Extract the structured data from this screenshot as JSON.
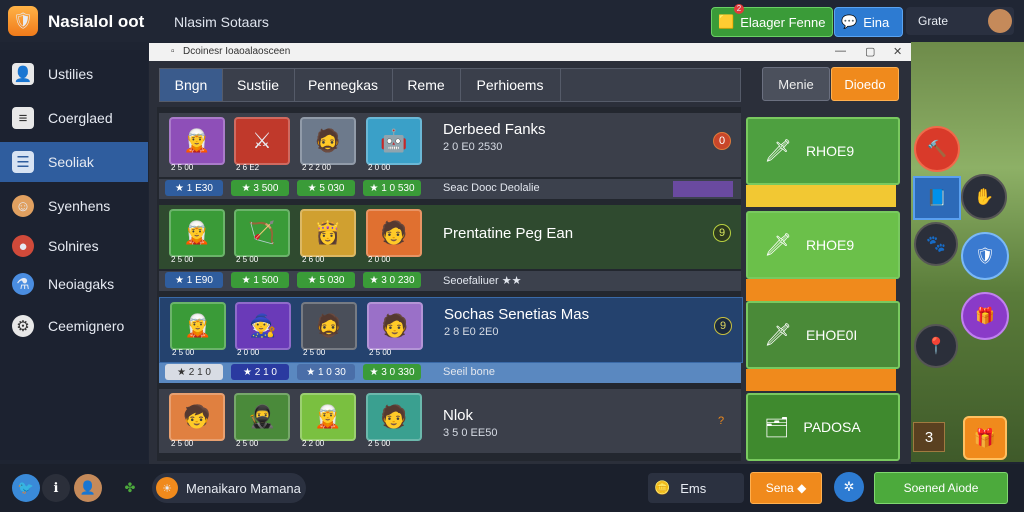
{
  "app": {
    "title": "Nasialol oot",
    "subtitle": "Nlasim Sotaars",
    "green_button": "Elaager Fenne",
    "blue_button": "Eina",
    "user_label": "Grate",
    "notification": "2"
  },
  "sidebar": {
    "items": [
      {
        "label": "Ustilies",
        "icon": "person-icon"
      },
      {
        "label": "Coerglaed",
        "icon": "document-icon"
      },
      {
        "label": "Seoliak",
        "icon": "list-icon",
        "active": true
      },
      {
        "label": "Syenhens",
        "icon": "hero-icon"
      },
      {
        "label": "Solnires",
        "icon": "mushroom-icon"
      },
      {
        "label": "Neoiagaks",
        "icon": "potion-icon"
      },
      {
        "label": "Ceemignero",
        "icon": "gear-icon"
      }
    ]
  },
  "window": {
    "title": "Dcoinesr Ioaoalaosceen",
    "tabs": [
      "Bngn",
      "Sustiie",
      "Pennegkas",
      "Reme",
      "Perhioems"
    ],
    "action_secondary": "Menie",
    "action_primary": "Dioedo"
  },
  "rows": [
    {
      "title": "Derbeed Fanks",
      "subtitle": "2 0 E0 2530",
      "badge": "0",
      "stats": [
        "1 E30",
        "3 500",
        "5 030",
        "1 0 530"
      ],
      "avatar_stats": [
        "2 5 00",
        "2 6 E2",
        "2 2 2 00",
        "2 0 00"
      ],
      "subtext": "Seac Dooc Deolalie",
      "action": "RHOE9",
      "bar": "yellow"
    },
    {
      "title": "Prentatine Peg Ean",
      "subtitle": "",
      "badge": "9",
      "stats": [
        "1 E90",
        "1 500",
        "5 030",
        "3 0 230"
      ],
      "avatar_stats": [
        "2 5 00",
        "2 5 00",
        "2 6 00",
        "2 0 00"
      ],
      "subtext": "Seoefaliuer ★★",
      "action": "RHOE9",
      "bar": "orange"
    },
    {
      "title": "Sochas Senetias Mas",
      "subtitle": "2 8 E0 2E0",
      "badge": "9",
      "stats": [
        "2 1 0",
        "2 1 0",
        "1 0 30",
        "3 0 330"
      ],
      "avatar_stats": [
        "2 5 00",
        "2 0 00",
        "2 5 00",
        "2 5 00"
      ],
      "subtext": "Seeil bone",
      "action": "EHOE0I",
      "bar": "orange"
    },
    {
      "title": "Nlok",
      "subtitle": "3 5 0 EE50",
      "badge": "?",
      "stats": [],
      "avatar_stats": [
        "2 5 00",
        "2 5 00",
        "2 2 00",
        "2 5 00"
      ],
      "subtext": "",
      "action": "PADOSA",
      "bar": ""
    }
  ],
  "scene": {
    "counter": "3"
  },
  "bottombar": {
    "player_name": "Menaikaro Mamana",
    "currency_label": "Ems",
    "orange_button": "Sena",
    "green_button": "Soened Aiode"
  },
  "colors": {
    "accent_blue": "#2f5d9e",
    "accent_orange": "#f08a1c",
    "accent_green": "#4caa3c"
  }
}
